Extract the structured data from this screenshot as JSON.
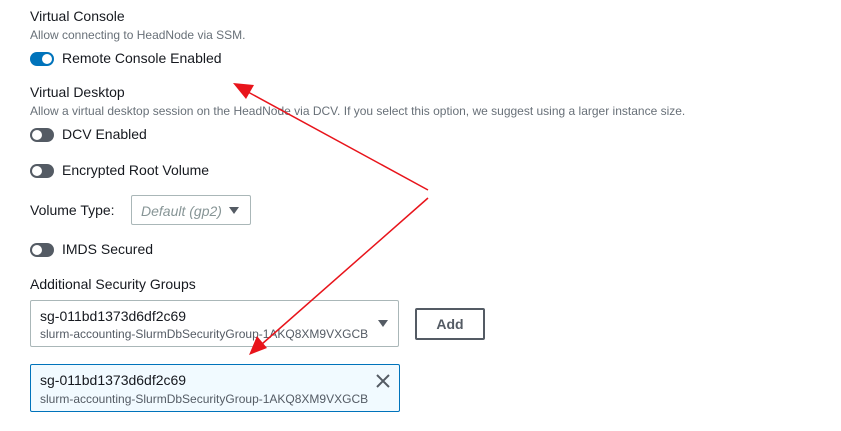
{
  "virtual_console": {
    "title": "Virtual Console",
    "description": "Allow connecting to HeadNode via SSM.",
    "toggle_label": "Remote Console Enabled",
    "toggle_on": true
  },
  "virtual_desktop": {
    "title": "Virtual Desktop",
    "description": "Allow a virtual desktop session on the HeadNode via DCV. If you select this option, we suggest using a larger instance size.",
    "toggle_label": "DCV Enabled",
    "toggle_on": false
  },
  "encrypted_root_volume": {
    "toggle_label": "Encrypted Root Volume",
    "toggle_on": false
  },
  "volume_type": {
    "label": "Volume Type:",
    "placeholder": "Default (gp2)"
  },
  "imds_secured": {
    "toggle_label": "IMDS Secured",
    "toggle_on": false
  },
  "additional_security_groups": {
    "title": "Additional Security Groups",
    "select": {
      "id": "sg-011bd1373d6df2c69",
      "name": "slurm-accounting-SlurmDbSecurityGroup-1AKQ8XM9VXGCB"
    },
    "add_label": "Add",
    "tokens": [
      {
        "id": "sg-011bd1373d6df2c69",
        "name": "slurm-accounting-SlurmDbSecurityGroup-1AKQ8XM9VXGCB"
      }
    ]
  },
  "colors": {
    "toggle_on": "#0073bb",
    "toggle_off": "#545b64",
    "annotation_arrow": "#e8141b"
  },
  "icons": {
    "dropdown": "caret-down-icon",
    "remove": "close-icon"
  }
}
